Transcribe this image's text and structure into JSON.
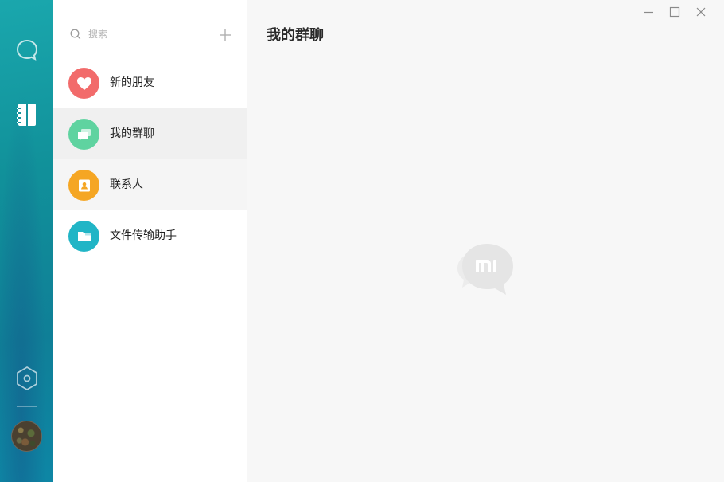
{
  "rail": {
    "items": [
      {
        "name": "chat",
        "icon": "chat-bubble-icon"
      },
      {
        "name": "contacts",
        "icon": "contacts-book-icon"
      },
      {
        "name": "settings",
        "icon": "hexagon-settings-icon"
      }
    ],
    "colors": {
      "gradient_top": "#1aa7ad",
      "gradient_bottom": "#0e86a5"
    }
  },
  "search": {
    "placeholder": "搜索",
    "icon": "search-icon",
    "add_icon": "plus-icon"
  },
  "list": {
    "items": [
      {
        "label": "新的朋友",
        "icon": "heart-icon",
        "color": "#f26b6b"
      },
      {
        "label": "我的群聊",
        "icon": "group-chat-icon",
        "color": "#5fd3a0"
      },
      {
        "label": "联系人",
        "icon": "contact-card-icon",
        "color": "#f5a623"
      },
      {
        "label": "文件传输助手",
        "icon": "folder-icon",
        "color": "#21b5c6"
      }
    ],
    "selected_index": 1
  },
  "main": {
    "title": "我的群聊",
    "watermark_icon": "mi-chat-logo-icon"
  },
  "window": {
    "controls": [
      "minimize-icon",
      "maximize-icon",
      "close-icon"
    ]
  }
}
